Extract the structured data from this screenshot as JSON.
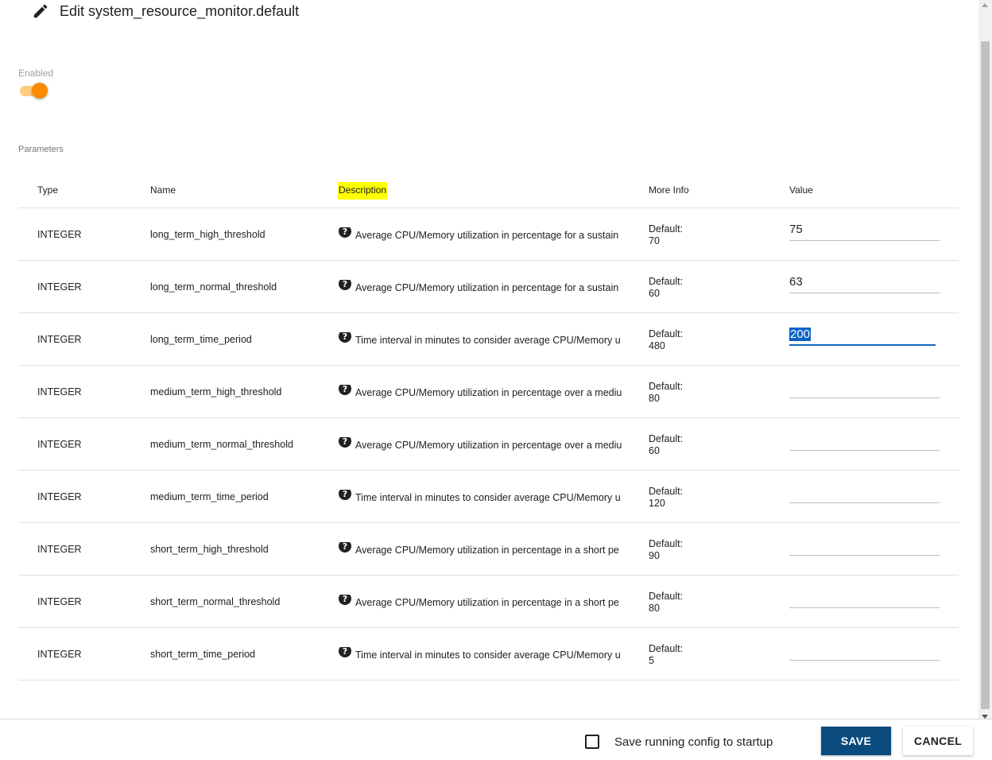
{
  "header": {
    "title": "Edit system_resource_monitor.default"
  },
  "enabled": {
    "label": "Enabled",
    "on": true,
    "accent": "#fb8c00"
  },
  "parameters": {
    "label": "Parameters",
    "columns": [
      "Type",
      "Name",
      "Description",
      "More Info",
      "Value"
    ],
    "rows": [
      {
        "type": "INTEGER",
        "name": "long_term_high_threshold",
        "description": "Average CPU/Memory utilization in percentage for a sustain",
        "info_label": "Default:",
        "info_value": "70",
        "value": "75"
      },
      {
        "type": "INTEGER",
        "name": "long_term_normal_threshold",
        "description": "Average CPU/Memory utilization in percentage for a sustain",
        "info_label": "Default:",
        "info_value": "60",
        "value": "63"
      },
      {
        "type": "INTEGER",
        "name": "long_term_time_period",
        "description": "Time interval in minutes to consider average CPU/Memory u",
        "info_label": "Default:",
        "info_value": "480",
        "value": "200"
      },
      {
        "type": "INTEGER",
        "name": "medium_term_high_threshold",
        "description": "Average CPU/Memory utilization in percentage over a mediu",
        "info_label": "Default:",
        "info_value": "80",
        "value": ""
      },
      {
        "type": "INTEGER",
        "name": "medium_term_normal_threshold",
        "description": "Average CPU/Memory utilization in percentage over a mediu",
        "info_label": "Default:",
        "info_value": "60",
        "value": ""
      },
      {
        "type": "INTEGER",
        "name": "medium_term_time_period",
        "description": "Time interval in minutes to consider average CPU/Memory u",
        "info_label": "Default:",
        "info_value": "120",
        "value": ""
      },
      {
        "type": "INTEGER",
        "name": "short_term_high_threshold",
        "description": "Average CPU/Memory utilization in percentage in a short pe",
        "info_label": "Default:",
        "info_value": "90",
        "value": ""
      },
      {
        "type": "INTEGER",
        "name": "short_term_normal_threshold",
        "description": "Average CPU/Memory utilization in percentage in a short pe",
        "info_label": "Default:",
        "info_value": "80",
        "value": ""
      },
      {
        "type": "INTEGER",
        "name": "short_term_time_period",
        "description": "Time interval in minutes to consider average CPU/Memory u",
        "info_label": "Default:",
        "info_value": "5",
        "value": ""
      }
    ]
  },
  "help_icon": {
    "glyph": "?",
    "icon": "help-circle-icon"
  },
  "footer": {
    "checkbox_label": "Save running config to startup",
    "checked": false,
    "save_label": "SAVE",
    "cancel_label": "CANCEL",
    "save_color": "#0b4a7d"
  },
  "highlight_color": "#ffff00",
  "selection_color": "#0a63c9"
}
